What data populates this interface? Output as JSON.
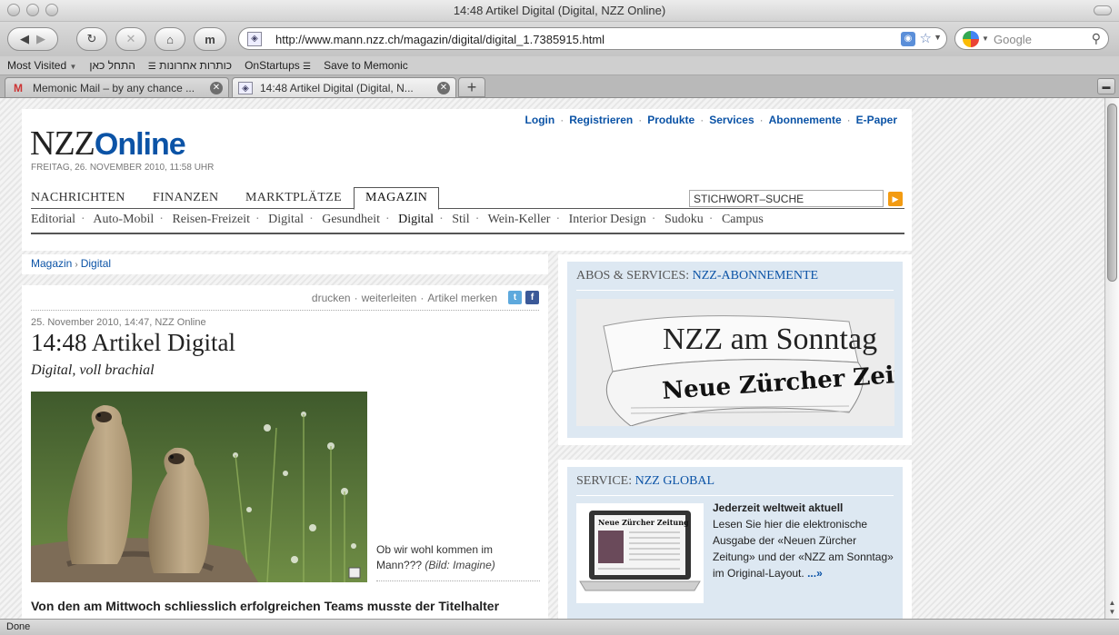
{
  "window": {
    "title": "14:48 Artikel Digital (Digital, NZZ Online)"
  },
  "toolbar": {
    "url": "http://www.mann.nzz.ch/magazin/digital/digital_1.7385915.html",
    "search_placeholder": "Google",
    "m_button": "m"
  },
  "bookmarks": [
    "Most Visited",
    "התחל כאן",
    "כותרות אחרונות",
    "OnStartups",
    "Save to Memonic"
  ],
  "tabs": [
    {
      "label": "Memonic Mail – by any chance ..."
    },
    {
      "label": "14:48 Artikel Digital (Digital, N..."
    }
  ],
  "status": "Done",
  "site": {
    "toplinks": [
      "Login",
      "Registrieren",
      "Produkte",
      "Services",
      "Abonnemente",
      "E-Paper"
    ],
    "logo_nzz": "NZZ",
    "logo_online": "Online",
    "dateline": "FREITAG, 26. NOVEMBER 2010, 11:58 UHR",
    "mainnav": [
      "NACHRICHTEN",
      "FINANZEN",
      "MARKTPLÄTZE",
      "MAGAZIN"
    ],
    "search_value": "STICHWORT–SUCHE",
    "subnav": [
      "Editorial",
      "Auto-Mobil",
      "Reisen-Freizeit",
      "Digital",
      "Gesundheit",
      "Digital",
      "Stil",
      "Wein-Keller",
      "Interior Design",
      "Sudoku",
      "Campus"
    ]
  },
  "breadcrumb": [
    "Magazin",
    "Digital"
  ],
  "article": {
    "tools": [
      "drucken",
      "weiterleiten",
      "Artikel merken"
    ],
    "meta": "25. November 2010, 14:47, NZZ Online",
    "headline": "14:48 Artikel Digital",
    "subhead": "Digital, voll brachial",
    "caption": "Ob wir wohl kommen im Mann???",
    "caption_credit": "(Bild: Imagine)",
    "lead": "Von den am Mittwoch schliesslich erfolgreichen Teams musste der Titelhalter"
  },
  "abos": {
    "label": "ABOS & SERVICES:",
    "link": "NZZ-ABONNEMENTE",
    "paper_top": "NZZ am Sonntag",
    "paper_bottom": "Neue Zürcher Zeitung"
  },
  "global": {
    "label": "SERVICE:",
    "link": "NZZ GLOBAL",
    "title": "Jederzeit weltweit aktuell",
    "text": "Lesen Sie hier die elektronische Ausgabe der «Neuen Zürcher Zeitung» und der «NZZ am Sonntag» im Original-Layout.",
    "more": "...»",
    "screen_title": "Neue Zürcher Zeitung"
  }
}
